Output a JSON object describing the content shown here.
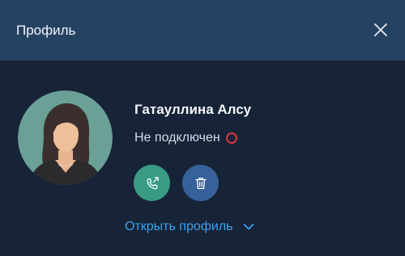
{
  "header": {
    "title": "Профиль",
    "close_icon": "close-icon"
  },
  "profile": {
    "name": "Гатауллина Алсу",
    "status_text": "Не подключен",
    "status_color": "#d9373f",
    "avatar_icon": "female-avatar-icon"
  },
  "actions": {
    "call_icon": "phone-forward-icon",
    "call_color": "#3a9b84",
    "delete_icon": "trash-icon",
    "delete_color": "#37619a"
  },
  "footer": {
    "open_profile_label": "Открыть профиль",
    "chevron_icon": "chevron-down-icon",
    "link_color": "#3aa2f0"
  },
  "colors": {
    "header_bg": "#264263",
    "body_bg": "#172337"
  }
}
